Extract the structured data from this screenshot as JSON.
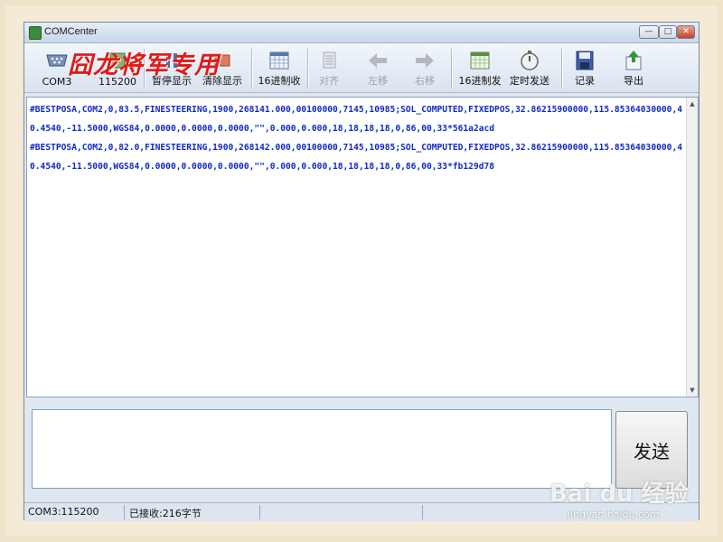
{
  "window": {
    "title": "COMCenter",
    "controls": {
      "minimize": "—",
      "maximize": "□",
      "close": "✕"
    }
  },
  "toolbar": {
    "watermark": "囧龙将军专用",
    "port_label": "COM3",
    "baud_label": "115200",
    "pause_label": "暂停显示",
    "clear_label": "清除显示",
    "hex_recv_label": "16进制收",
    "align_label": "对齐",
    "shift_left_label": "左移",
    "shift_right_label": "右移",
    "hex_send_label": "16进制发",
    "timed_send_label": "定时发送",
    "record_label": "记录",
    "export_label": "导出"
  },
  "output": {
    "lines": [
      "#BESTPOSA,COM2,0,83.5,FINESTEERING,1900,268141.000,00100000,7145,10985;SOL_COMPUTED,FIXEDPOS,32.86215900000,115.85364030000,40.4540,-11.5000,WGS84,0.0000,0.0000,0.0000,\"\",0.000,0.000,18,18,18,18,0,86,00,33*561a2acd",
      "#BESTPOSA,COM2,0,82.0,FINESTEERING,1900,268142.000,00100000,7145,10985;SOL_COMPUTED,FIXEDPOS,32.86215900000,115.85364030000,40.4540,-11.5000,WGS84,0.0000,0.0000,0.0000,\"\",0.000,0.000,18,18,18,18,0,86,00,33*fb129d78"
    ]
  },
  "input": {
    "value": ""
  },
  "send_label": "发送",
  "status": {
    "port": "COM3:115200",
    "received": "已接收:216字节"
  },
  "watermark_site": {
    "logo": "Bai du 经验",
    "url": "jingyan.baidu.com"
  },
  "colors": {
    "output_text": "#1228c8",
    "watermark": "#e21a1a"
  }
}
